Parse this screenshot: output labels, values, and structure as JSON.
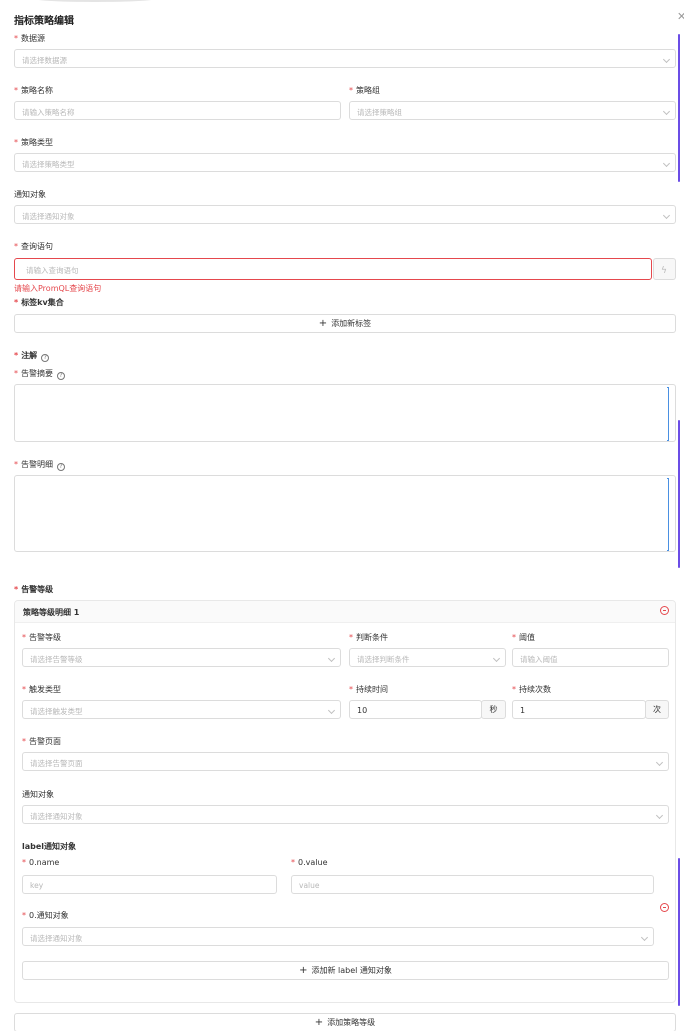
{
  "dialog": {
    "title": "指标策略编辑",
    "close_icon": "close-icon"
  },
  "datasource": {
    "label": "数据源",
    "placeholder": "请选择数据源"
  },
  "rule_name": {
    "label": "策略名称",
    "placeholder": "请输入策略名称"
  },
  "rule_group": {
    "label": "策略组",
    "placeholder": "请选择策略组"
  },
  "rule_type": {
    "label": "策略类型",
    "placeholder": "请选择策略类型"
  },
  "notify_target": {
    "label": "通知对象",
    "placeholder": "请选择通知对象"
  },
  "query": {
    "label": "查询语句",
    "placeholder": "请输入查询语句",
    "error": "请输入PromQL查询语句"
  },
  "labels_kv": {
    "label": "标签kv集合",
    "add_button": "添加新标签"
  },
  "annotations": {
    "label": "注解",
    "summary_label": "告警摘要",
    "detail_label": "告警明细"
  },
  "alert_levels": {
    "label": "告警等级",
    "card": {
      "title": "策略等级明细 1",
      "level_label": "告警等级",
      "level_placeholder": "请选择告警等级",
      "condition_label": "判断条件",
      "condition_placeholder": "请选择判断条件",
      "threshold_label": "阈值",
      "threshold_placeholder": "请输入阈值",
      "trigger_type_label": "触发类型",
      "trigger_type_placeholder": "请选择触发类型",
      "duration_label": "持续时间",
      "duration_value": "10",
      "duration_unit": "秒",
      "count_label": "持续次数",
      "count_value": "1",
      "count_unit": "次",
      "page_label": "告警页面",
      "page_placeholder": "请选择告警页面",
      "notify_label": "通知对象",
      "notify_placeholder": "请选择通知对象",
      "label_notify": {
        "title": "label通知对象",
        "name_label": "0.name",
        "name_placeholder": "key",
        "value_label": "0.value",
        "value_placeholder": "value",
        "target_label": "0.通知对象",
        "target_placeholder": "请选择通知对象",
        "add_button": "添加新 label 通知对象"
      }
    },
    "add_button": "添加策略等级"
  },
  "colors": {
    "required": "#e5484d",
    "accent": "#6b4de6",
    "border": "#dcdcdc"
  }
}
